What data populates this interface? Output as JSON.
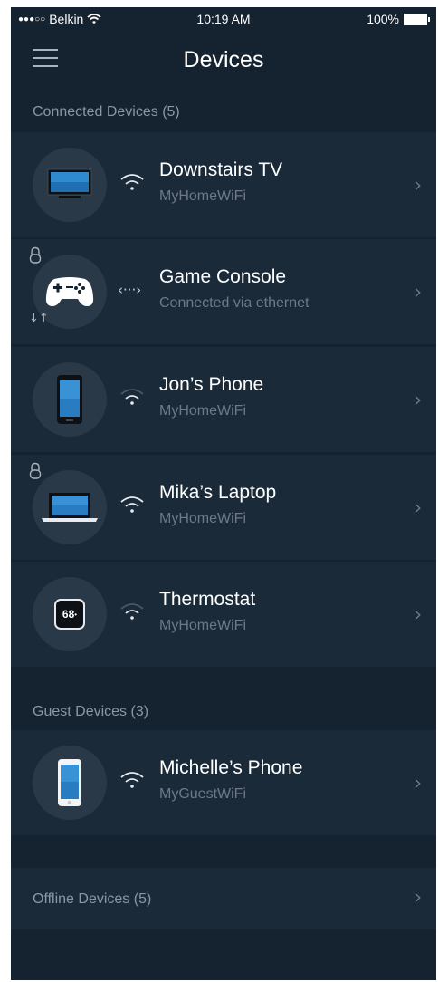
{
  "status": {
    "carrier": "Belkin",
    "time": "10:19 AM",
    "battery": "100%"
  },
  "header": {
    "title": "Devices"
  },
  "connected": {
    "header": "Connected Devices (5)",
    "devices": [
      {
        "name": "Downstairs TV",
        "network": "MyHomeWiFi",
        "icon": "tv-icon",
        "connection": "wifi-strong"
      },
      {
        "name": "Game Console",
        "network": "Connected via ethernet",
        "icon": "gamepad-icon",
        "connection": "ethernet"
      },
      {
        "name": "Jon’s Phone",
        "network": "MyHomeWiFi",
        "icon": "phone-icon",
        "connection": "wifi-weak"
      },
      {
        "name": "Mika’s Laptop",
        "network": "MyHomeWiFi",
        "icon": "laptop-icon",
        "connection": "wifi-strong"
      },
      {
        "name": "Thermostat",
        "network": "MyHomeWiFi",
        "icon": "thermostat-icon",
        "connection": "wifi-weak",
        "display": "68"
      }
    ]
  },
  "guest": {
    "header": "Guest Devices  (3)",
    "devices": [
      {
        "name": "Michelle’s Phone",
        "network": "MyGuestWiFi",
        "icon": "phone-icon",
        "connection": "wifi-strong"
      }
    ]
  },
  "offline": {
    "label": "Offline Devices  (5)"
  },
  "colors": {
    "background": "#152230",
    "row": "#1b2a38",
    "avatar": "#2a3947",
    "text_primary": "#ffffff",
    "text_secondary": "#6d7986"
  }
}
